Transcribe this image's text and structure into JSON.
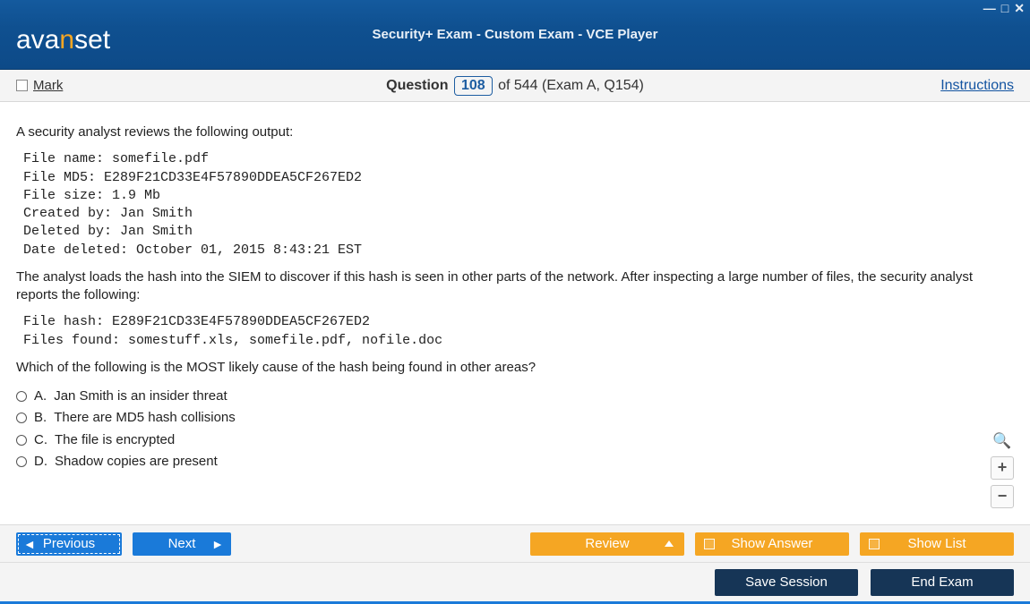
{
  "window": {
    "title": "Security+ Exam - Custom Exam - VCE Player",
    "logo_pre": "ava",
    "logo_n": "n",
    "logo_post": "set"
  },
  "topbar": {
    "mark_label": "Mark",
    "question_label": "Question",
    "current": "108",
    "of_text": "of 544 (Exam A, Q154)",
    "instructions": "Instructions"
  },
  "question": {
    "intro": "A security analyst reviews the following output:",
    "output1": "File name: somefile.pdf\nFile MD5: E289F21CD33E4F57890DDEA5CF267ED2\nFile size: 1.9 Mb\nCreated by: Jan Smith\nDeleted by: Jan Smith\nDate deleted: October 01, 2015 8:43:21 EST",
    "mid": "The analyst loads the hash into the SIEM to discover if this hash is seen in other parts of the network. After inspecting a large number of files, the security analyst reports the following:",
    "output2": "File hash: E289F21CD33E4F57890DDEA5CF267ED2\nFiles found: somestuff.xls, somefile.pdf, nofile.doc",
    "prompt": "Which of the following is the MOST likely cause of the hash being found in other areas?",
    "options": [
      {
        "letter": "A.",
        "text": "Jan Smith is an insider threat"
      },
      {
        "letter": "B.",
        "text": "There are MD5 hash collisions"
      },
      {
        "letter": "C.",
        "text": "The file is encrypted"
      },
      {
        "letter": "D.",
        "text": "Shadow copies are present"
      }
    ]
  },
  "nav": {
    "previous": "Previous",
    "next": "Next",
    "review": "Review",
    "show_answer": "Show Answer",
    "show_list": "Show List"
  },
  "footer": {
    "save": "Save Session",
    "end": "End Exam"
  },
  "zoom": {
    "plus": "+",
    "minus": "−"
  }
}
